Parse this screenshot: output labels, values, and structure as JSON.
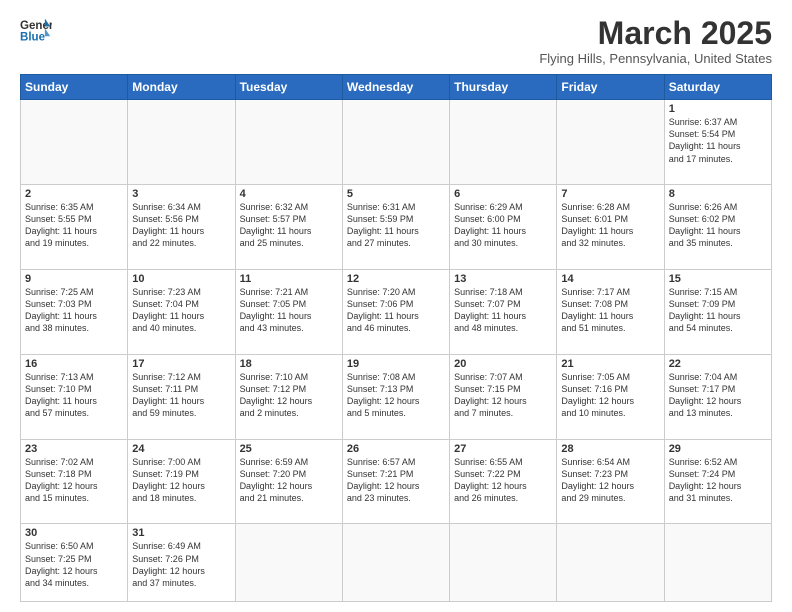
{
  "header": {
    "logo_general": "General",
    "logo_blue": "Blue",
    "month": "March 2025",
    "location": "Flying Hills, Pennsylvania, United States"
  },
  "weekdays": [
    "Sunday",
    "Monday",
    "Tuesday",
    "Wednesday",
    "Thursday",
    "Friday",
    "Saturday"
  ],
  "weeks": [
    [
      {
        "day": "",
        "info": ""
      },
      {
        "day": "",
        "info": ""
      },
      {
        "day": "",
        "info": ""
      },
      {
        "day": "",
        "info": ""
      },
      {
        "day": "",
        "info": ""
      },
      {
        "day": "",
        "info": ""
      },
      {
        "day": "1",
        "info": "Sunrise: 6:37 AM\nSunset: 5:54 PM\nDaylight: 11 hours\nand 17 minutes."
      }
    ],
    [
      {
        "day": "2",
        "info": "Sunrise: 6:35 AM\nSunset: 5:55 PM\nDaylight: 11 hours\nand 19 minutes."
      },
      {
        "day": "3",
        "info": "Sunrise: 6:34 AM\nSunset: 5:56 PM\nDaylight: 11 hours\nand 22 minutes."
      },
      {
        "day": "4",
        "info": "Sunrise: 6:32 AM\nSunset: 5:57 PM\nDaylight: 11 hours\nand 25 minutes."
      },
      {
        "day": "5",
        "info": "Sunrise: 6:31 AM\nSunset: 5:59 PM\nDaylight: 11 hours\nand 27 minutes."
      },
      {
        "day": "6",
        "info": "Sunrise: 6:29 AM\nSunset: 6:00 PM\nDaylight: 11 hours\nand 30 minutes."
      },
      {
        "day": "7",
        "info": "Sunrise: 6:28 AM\nSunset: 6:01 PM\nDaylight: 11 hours\nand 32 minutes."
      },
      {
        "day": "8",
        "info": "Sunrise: 6:26 AM\nSunset: 6:02 PM\nDaylight: 11 hours\nand 35 minutes."
      }
    ],
    [
      {
        "day": "9",
        "info": "Sunrise: 7:25 AM\nSunset: 7:03 PM\nDaylight: 11 hours\nand 38 minutes."
      },
      {
        "day": "10",
        "info": "Sunrise: 7:23 AM\nSunset: 7:04 PM\nDaylight: 11 hours\nand 40 minutes."
      },
      {
        "day": "11",
        "info": "Sunrise: 7:21 AM\nSunset: 7:05 PM\nDaylight: 11 hours\nand 43 minutes."
      },
      {
        "day": "12",
        "info": "Sunrise: 7:20 AM\nSunset: 7:06 PM\nDaylight: 11 hours\nand 46 minutes."
      },
      {
        "day": "13",
        "info": "Sunrise: 7:18 AM\nSunset: 7:07 PM\nDaylight: 11 hours\nand 48 minutes."
      },
      {
        "day": "14",
        "info": "Sunrise: 7:17 AM\nSunset: 7:08 PM\nDaylight: 11 hours\nand 51 minutes."
      },
      {
        "day": "15",
        "info": "Sunrise: 7:15 AM\nSunset: 7:09 PM\nDaylight: 11 hours\nand 54 minutes."
      }
    ],
    [
      {
        "day": "16",
        "info": "Sunrise: 7:13 AM\nSunset: 7:10 PM\nDaylight: 11 hours\nand 57 minutes."
      },
      {
        "day": "17",
        "info": "Sunrise: 7:12 AM\nSunset: 7:11 PM\nDaylight: 11 hours\nand 59 minutes."
      },
      {
        "day": "18",
        "info": "Sunrise: 7:10 AM\nSunset: 7:12 PM\nDaylight: 12 hours\nand 2 minutes."
      },
      {
        "day": "19",
        "info": "Sunrise: 7:08 AM\nSunset: 7:13 PM\nDaylight: 12 hours\nand 5 minutes."
      },
      {
        "day": "20",
        "info": "Sunrise: 7:07 AM\nSunset: 7:15 PM\nDaylight: 12 hours\nand 7 minutes."
      },
      {
        "day": "21",
        "info": "Sunrise: 7:05 AM\nSunset: 7:16 PM\nDaylight: 12 hours\nand 10 minutes."
      },
      {
        "day": "22",
        "info": "Sunrise: 7:04 AM\nSunset: 7:17 PM\nDaylight: 12 hours\nand 13 minutes."
      }
    ],
    [
      {
        "day": "23",
        "info": "Sunrise: 7:02 AM\nSunset: 7:18 PM\nDaylight: 12 hours\nand 15 minutes."
      },
      {
        "day": "24",
        "info": "Sunrise: 7:00 AM\nSunset: 7:19 PM\nDaylight: 12 hours\nand 18 minutes."
      },
      {
        "day": "25",
        "info": "Sunrise: 6:59 AM\nSunset: 7:20 PM\nDaylight: 12 hours\nand 21 minutes."
      },
      {
        "day": "26",
        "info": "Sunrise: 6:57 AM\nSunset: 7:21 PM\nDaylight: 12 hours\nand 23 minutes."
      },
      {
        "day": "27",
        "info": "Sunrise: 6:55 AM\nSunset: 7:22 PM\nDaylight: 12 hours\nand 26 minutes."
      },
      {
        "day": "28",
        "info": "Sunrise: 6:54 AM\nSunset: 7:23 PM\nDaylight: 12 hours\nand 29 minutes."
      },
      {
        "day": "29",
        "info": "Sunrise: 6:52 AM\nSunset: 7:24 PM\nDaylight: 12 hours\nand 31 minutes."
      }
    ],
    [
      {
        "day": "30",
        "info": "Sunrise: 6:50 AM\nSunset: 7:25 PM\nDaylight: 12 hours\nand 34 minutes."
      },
      {
        "day": "31",
        "info": "Sunrise: 6:49 AM\nSunset: 7:26 PM\nDaylight: 12 hours\nand 37 minutes."
      },
      {
        "day": "",
        "info": ""
      },
      {
        "day": "",
        "info": ""
      },
      {
        "day": "",
        "info": ""
      },
      {
        "day": "",
        "info": ""
      },
      {
        "day": "",
        "info": ""
      }
    ]
  ]
}
